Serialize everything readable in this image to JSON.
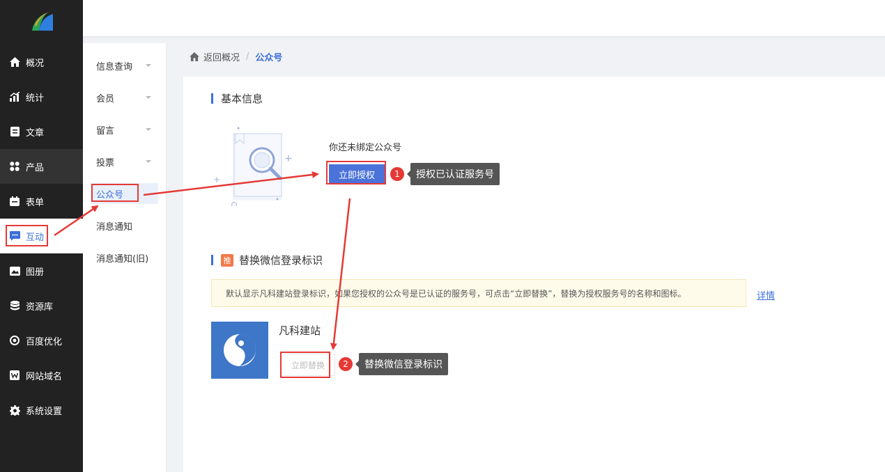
{
  "sidebar": {
    "items": [
      {
        "label": "概况",
        "icon": "home-icon"
      },
      {
        "label": "统计",
        "icon": "chart-icon"
      },
      {
        "label": "文章",
        "icon": "article-icon"
      },
      {
        "label": "产品",
        "icon": "grid-icon"
      },
      {
        "label": "表单",
        "icon": "calendar-icon"
      },
      {
        "label": "互动",
        "icon": "chat-icon"
      },
      {
        "label": "图册",
        "icon": "album-icon"
      },
      {
        "label": "资源库",
        "icon": "database-icon"
      },
      {
        "label": "百度优化",
        "icon": "target-icon"
      },
      {
        "label": "网站域名",
        "icon": "w-icon"
      },
      {
        "label": "系统设置",
        "icon": "gear-icon"
      }
    ]
  },
  "subnav": {
    "items": [
      {
        "label": "信息查询"
      },
      {
        "label": "会员"
      },
      {
        "label": "留言"
      },
      {
        "label": "投票"
      },
      {
        "label": "公众号"
      },
      {
        "label": "消息通知"
      },
      {
        "label": "消息通知(旧)"
      }
    ]
  },
  "breadcrumb": {
    "back": "返回概况",
    "sep": "/",
    "current": "公众号"
  },
  "basic": {
    "title": "基本信息",
    "not_bound": "你还未绑定公众号",
    "auth_button": "立即授权"
  },
  "replace": {
    "tag": "推",
    "title": "替换微信登录标识",
    "notice": "默认显示凡科建站登录标识，如果您授权的公众号是已认证的服务号，可点击“立即替换”，替换为授权服务号的名称和图标。",
    "detail": "详情",
    "brand_name": "凡科建站",
    "replace_button": "立即替换"
  },
  "annotations": [
    {
      "num": "1",
      "text": "授权已认证服务号"
    },
    {
      "num": "2",
      "text": "替换微信登录标识"
    }
  ],
  "colors": {
    "accent": "#4a72d9",
    "sidebar_bg": "#222222",
    "annotation_red": "#e53935"
  }
}
